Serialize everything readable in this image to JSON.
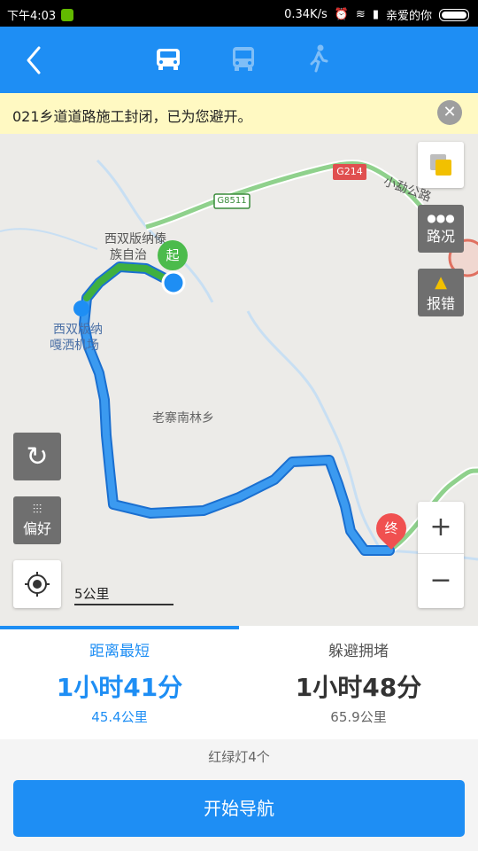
{
  "status_bar": {
    "time": "下午4:03",
    "net_speed": "0.34K/s",
    "carrier": "亲爱的你"
  },
  "nav": {
    "modes": [
      {
        "icon": "car-icon",
        "active": true
      },
      {
        "icon": "bus-icon",
        "active": false
      },
      {
        "icon": "walk-icon",
        "active": false
      }
    ]
  },
  "notice": {
    "text": "021乡道道路施工封闭，已为您避开。",
    "close": "✕"
  },
  "map": {
    "labels": {
      "town1": "西双版纳傣",
      "town2": "族自治",
      "airport1": "西双版纳",
      "airport2": "嘎洒机场",
      "township": "老寨南林乡",
      "road_right": "小勐公路",
      "g214": "G214",
      "g8511": "G8511"
    },
    "start_marker": "起",
    "end_marker": "终",
    "traffic_label": "路况",
    "report_label": "报错",
    "preference_label": "偏好",
    "scale": "5公里",
    "zoom_in": "+",
    "zoom_out": "−"
  },
  "routes": [
    {
      "name": "距离最短",
      "time": "1小时41分",
      "distance": "45.4公里",
      "selected": true
    },
    {
      "name": "躲避拥堵",
      "time": "1小时48分",
      "distance": "65.9公里",
      "selected": false
    }
  ],
  "traffic_lights": "红绿灯4个",
  "start_navigation": "开始导航",
  "colors": {
    "accent": "#1e8ef4",
    "route": "#2a86e8",
    "road_green": "#5cb85c"
  }
}
